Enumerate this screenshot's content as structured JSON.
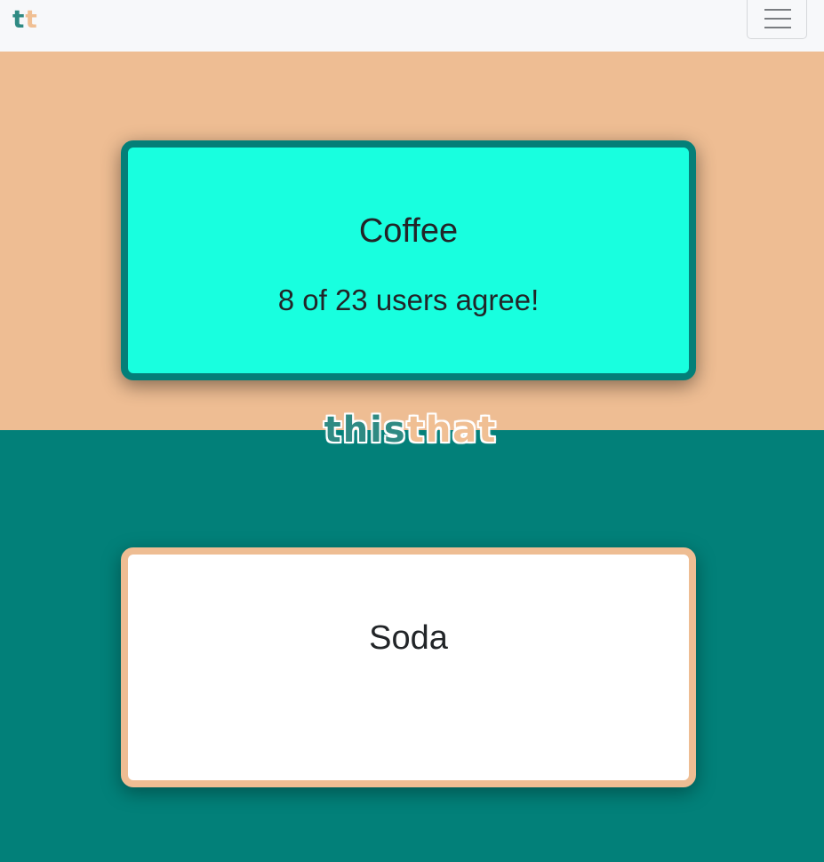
{
  "navbar": {
    "brand_first": "t",
    "brand_second": "t",
    "menu_icon": "hamburger-menu-icon"
  },
  "logo": {
    "word_this": "this",
    "word_that": "that"
  },
  "cards": {
    "this": {
      "title": "Coffee",
      "result": "8 of 23 users agree!"
    },
    "that": {
      "title": "Soda"
    }
  },
  "colors": {
    "this_accent": "#028079",
    "that_accent": "#eebd93",
    "selected_card_bg": "#18ffdf",
    "unselected_card_bg": "#ffffff"
  }
}
